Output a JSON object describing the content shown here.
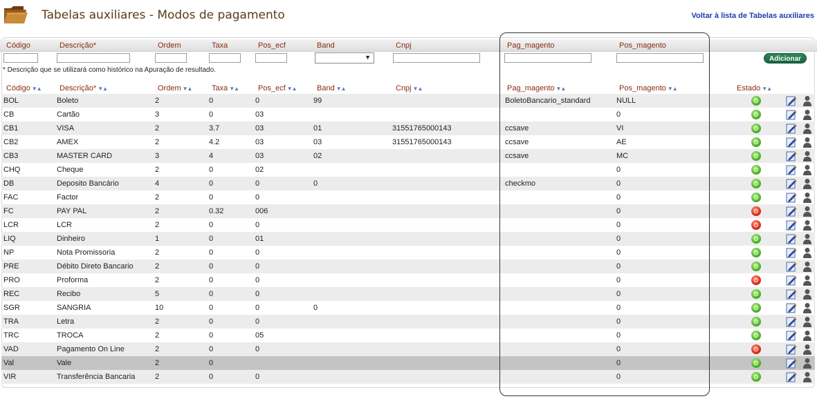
{
  "header": {
    "title": "Tabelas auxiliares - Modos de pagamento",
    "back_link": "Voltar à lista de Tabelas auxiliares"
  },
  "form": {
    "labels": {
      "codigo": "Código",
      "descricao": "Descrição*",
      "ordem": "Ordem",
      "taxa": "Taxa",
      "pos_ecf": "Pos_ecf",
      "band": "Band",
      "cnpj": "Cnpj",
      "pag_magento": "Pag_magento",
      "pos_magento": "Pos_magento"
    },
    "band_selected": "",
    "add_label": "Adicionar",
    "note": "* Descrição que se utilizará como histórico na Apuração de resultado."
  },
  "table": {
    "headers": {
      "codigo": "Código",
      "descricao": "Descrição*",
      "ordem": "Ordem",
      "taxa": "Taxa",
      "pos_ecf": "Pos_ecf",
      "band": "Band",
      "cnpj": "Cnpj",
      "pag_magento": "Pag_magento",
      "pos_magento": "Pos_magento",
      "estado": "Estado"
    },
    "rows": [
      {
        "codigo": "BOL",
        "descricao": "Boleto",
        "ordem": "2",
        "taxa": "0",
        "pos_ecf": "0",
        "band": "99",
        "cnpj": "",
        "pag_magento": "BoletoBancario_standard",
        "pos_magento": "NULL",
        "estado": "on"
      },
      {
        "codigo": "CB",
        "descricao": "Cartão",
        "ordem": "3",
        "taxa": "0",
        "pos_ecf": "03",
        "band": "",
        "cnpj": "",
        "pag_magento": "",
        "pos_magento": "0",
        "estado": "on"
      },
      {
        "codigo": "CB1",
        "descricao": "VISA",
        "ordem": "2",
        "taxa": "3.7",
        "pos_ecf": "03",
        "band": "01",
        "cnpj": "31551765000143",
        "pag_magento": "ccsave",
        "pos_magento": "VI",
        "estado": "on"
      },
      {
        "codigo": "CB2",
        "descricao": "AMEX",
        "ordem": "2",
        "taxa": "4.2",
        "pos_ecf": "03",
        "band": "03",
        "cnpj": "31551765000143",
        "pag_magento": "ccsave",
        "pos_magento": "AE",
        "estado": "on"
      },
      {
        "codigo": "CB3",
        "descricao": "MASTER CARD",
        "ordem": "3",
        "taxa": "4",
        "pos_ecf": "03",
        "band": "02",
        "cnpj": "",
        "pag_magento": "ccsave",
        "pos_magento": "MC",
        "estado": "on"
      },
      {
        "codigo": "CHQ",
        "descricao": "Cheque",
        "ordem": "2",
        "taxa": "0",
        "pos_ecf": "02",
        "band": "",
        "cnpj": "",
        "pag_magento": "",
        "pos_magento": "0",
        "estado": "on"
      },
      {
        "codigo": "DB",
        "descricao": "Deposito Bancário",
        "ordem": "4",
        "taxa": "0",
        "pos_ecf": "0",
        "band": "0",
        "cnpj": "",
        "pag_magento": "checkmo",
        "pos_magento": "0",
        "estado": "on"
      },
      {
        "codigo": "FAC",
        "descricao": "Factor",
        "ordem": "2",
        "taxa": "0",
        "pos_ecf": "0",
        "band": "",
        "cnpj": "",
        "pag_magento": "",
        "pos_magento": "0",
        "estado": "on"
      },
      {
        "codigo": "FC",
        "descricao": "PAY PAL",
        "ordem": "2",
        "taxa": "0.32",
        "pos_ecf": "006",
        "band": "",
        "cnpj": "",
        "pag_magento": "",
        "pos_magento": "0",
        "estado": "off"
      },
      {
        "codigo": "LCR",
        "descricao": "LCR",
        "ordem": "2",
        "taxa": "0",
        "pos_ecf": "0",
        "band": "",
        "cnpj": "",
        "pag_magento": "",
        "pos_magento": "0",
        "estado": "off"
      },
      {
        "codigo": "LIQ",
        "descricao": "Dinheiro",
        "ordem": "1",
        "taxa": "0",
        "pos_ecf": "01",
        "band": "",
        "cnpj": "",
        "pag_magento": "",
        "pos_magento": "0",
        "estado": "on"
      },
      {
        "codigo": "NP",
        "descricao": "Nota Promissoria",
        "ordem": "2",
        "taxa": "0",
        "pos_ecf": "0",
        "band": "",
        "cnpj": "",
        "pag_magento": "",
        "pos_magento": "0",
        "estado": "on"
      },
      {
        "codigo": "PRE",
        "descricao": "Débito Direto Bancario",
        "ordem": "2",
        "taxa": "0",
        "pos_ecf": "0",
        "band": "",
        "cnpj": "",
        "pag_magento": "",
        "pos_magento": "0",
        "estado": "on"
      },
      {
        "codigo": "PRO",
        "descricao": "Proforma",
        "ordem": "2",
        "taxa": "0",
        "pos_ecf": "0",
        "band": "",
        "cnpj": "",
        "pag_magento": "",
        "pos_magento": "0",
        "estado": "off"
      },
      {
        "codigo": "REC",
        "descricao": "Recibo",
        "ordem": "5",
        "taxa": "0",
        "pos_ecf": "0",
        "band": "",
        "cnpj": "",
        "pag_magento": "",
        "pos_magento": "0",
        "estado": "on"
      },
      {
        "codigo": "SGR",
        "descricao": "SANGRIA",
        "ordem": "10",
        "taxa": "0",
        "pos_ecf": "0",
        "band": "0",
        "cnpj": "",
        "pag_magento": "",
        "pos_magento": "0",
        "estado": "on"
      },
      {
        "codigo": "TRA",
        "descricao": "Letra",
        "ordem": "2",
        "taxa": "0",
        "pos_ecf": "0",
        "band": "",
        "cnpj": "",
        "pag_magento": "",
        "pos_magento": "0",
        "estado": "on"
      },
      {
        "codigo": "TRC",
        "descricao": "TROCA",
        "ordem": "2",
        "taxa": "0",
        "pos_ecf": "05",
        "band": "",
        "cnpj": "",
        "pag_magento": "",
        "pos_magento": "0",
        "estado": "on"
      },
      {
        "codigo": "VAD",
        "descricao": "Pagamento On Line",
        "ordem": "2",
        "taxa": "0",
        "pos_ecf": "0",
        "band": "",
        "cnpj": "",
        "pag_magento": "",
        "pos_magento": "0",
        "estado": "off"
      },
      {
        "codigo": "Val",
        "descricao": "Vale",
        "ordem": "2",
        "taxa": "0",
        "pos_ecf": "",
        "band": "",
        "cnpj": "",
        "pag_magento": "",
        "pos_magento": "0",
        "estado": "on"
      },
      {
        "codigo": "VIR",
        "descricao": "Transferência Bancaria",
        "ordem": "2",
        "taxa": "0",
        "pos_ecf": "0",
        "band": "",
        "cnpj": "",
        "pag_magento": "",
        "pos_magento": "0",
        "estado": "on"
      }
    ]
  },
  "icons": {
    "folder": "folder-icon",
    "sort": "sort-arrows-icon",
    "status_on": "status-active-icon",
    "status_off": "status-inactive-icon",
    "edit": "edit-icon",
    "user": "user-icon"
  },
  "colors": {
    "accent_title": "#5a3a1a",
    "header_text": "#8a2a10",
    "link": "#1a3fb0",
    "add_button": "#17653e",
    "status_on": "#4fb32a",
    "status_off": "#e02a18",
    "row_alt": "#ececec",
    "row_selected": "#c4c4c4"
  }
}
